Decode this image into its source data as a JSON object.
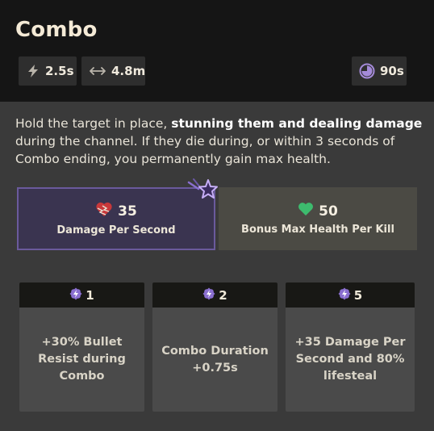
{
  "ability": {
    "title": "Combo",
    "stats": {
      "cast_time": "2.5s",
      "range": "4.8m",
      "cooldown": "90s"
    },
    "description": {
      "part1": "Hold the target in place, ",
      "bold": "stunning them and dealing damage",
      "part2": " during the channel. If they die during, or within 3 seconds of Combo ending, you permanently gain max health."
    },
    "properties": [
      {
        "value": "35",
        "label": "Damage Per Second",
        "icon": "broken-heart-icon"
      },
      {
        "value": "50",
        "label": "Bonus Max Health Per Kill",
        "icon": "heart-icon"
      }
    ],
    "upgrades": [
      {
        "tier": "1",
        "text": "+30% Bullet Resist during Combo"
      },
      {
        "tier": "2",
        "text": "Combo Duration +0.75s"
      },
      {
        "tier": "5",
        "text": "+35 Damage Per Second and 80% lifesteal"
      }
    ],
    "colors": {
      "accent_purple": "#8a6fd0",
      "heart_green": "#3dbb6e",
      "heart_red": "#c8383a"
    }
  }
}
